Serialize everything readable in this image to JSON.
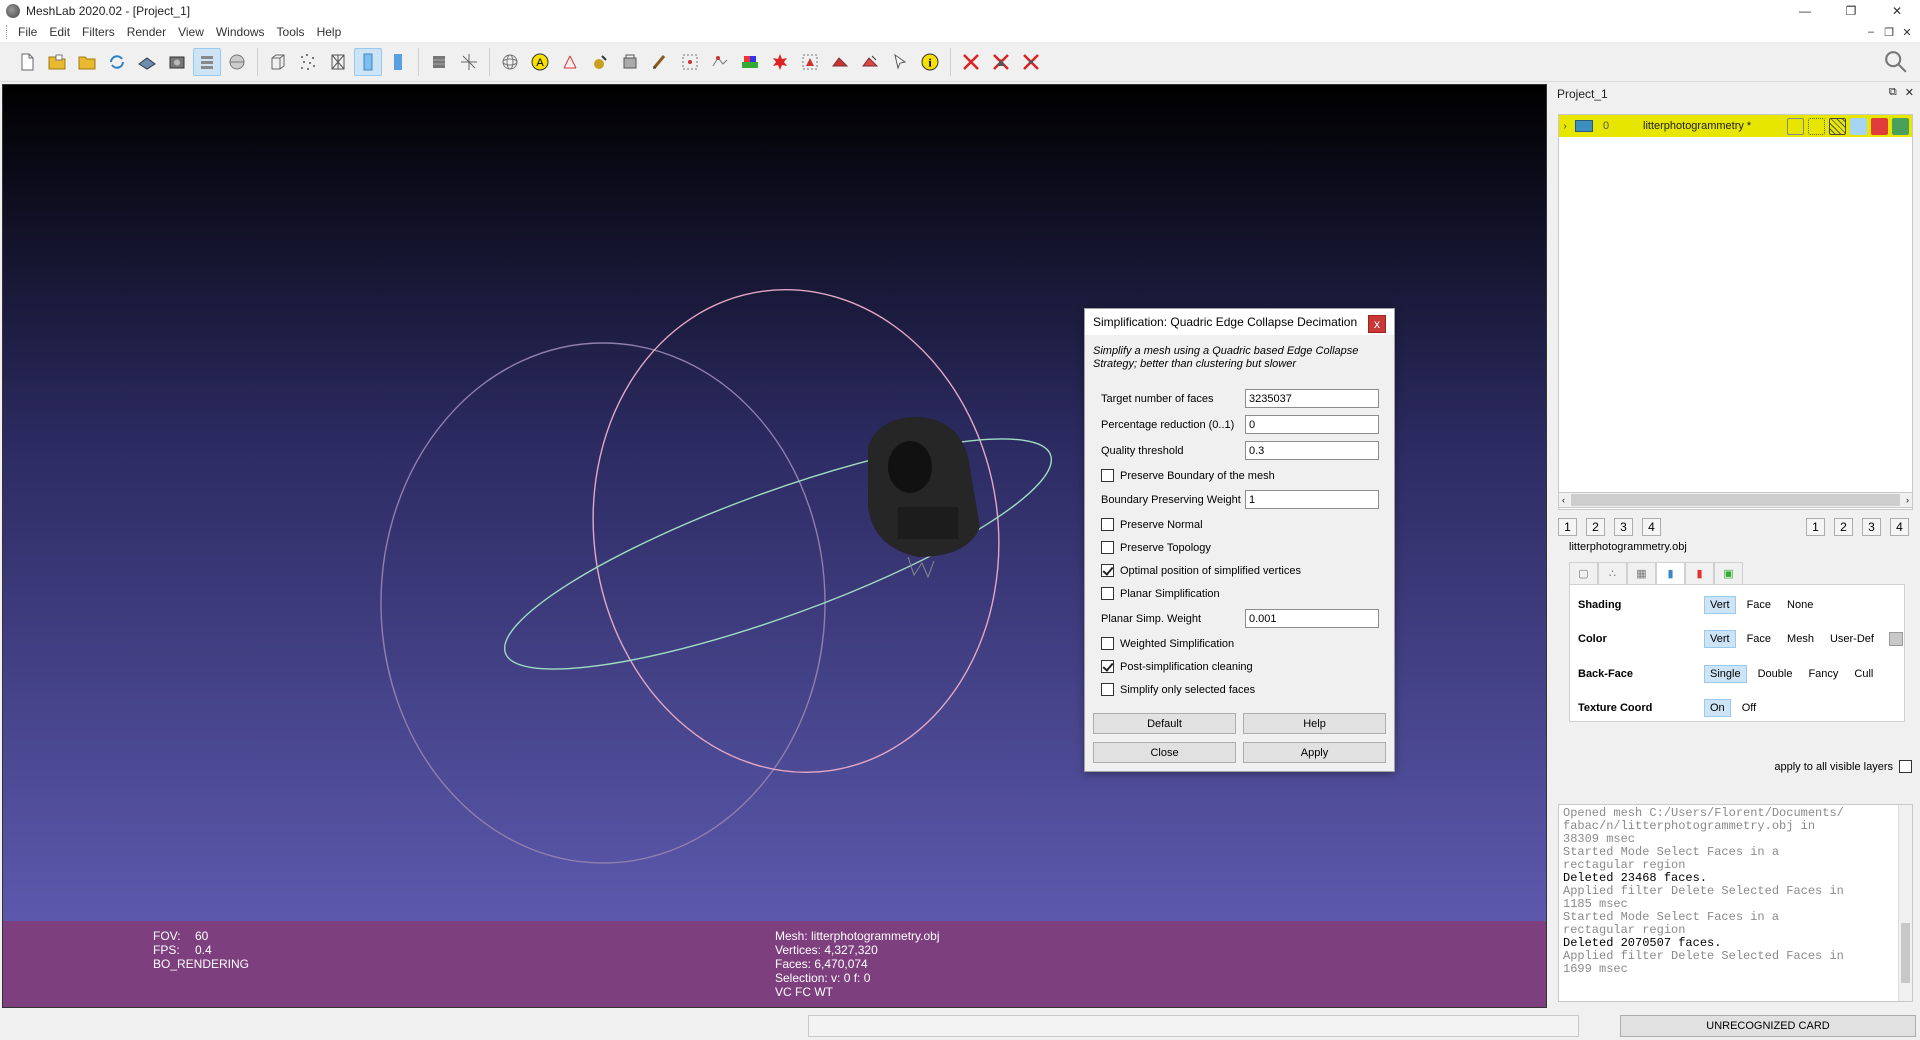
{
  "window": {
    "title": "MeshLab 2020.02 - [Project_1]",
    "controls": {
      "minimize": "—",
      "restore": "❐",
      "close": "✕"
    }
  },
  "menu": {
    "items": [
      "File",
      "Edit",
      "Filters",
      "Render",
      "View",
      "Windows",
      "Tools",
      "Help"
    ],
    "mdi_controls": {
      "minimize": "–",
      "restore": "❐",
      "close": "✕"
    }
  },
  "toolbar": {
    "icons": [
      "new-project-icon",
      "open-project-icon",
      "open-mesh-icon",
      "reload-icon",
      "save-icon",
      "snapshot-icon",
      "layers-icon",
      "render-points-icon",
      "bbox-icon",
      "points-icon",
      "wireframe-icon",
      "smooth-icon",
      "texture-icon",
      "lighting-icon",
      "axis-icon",
      "trackball-icon",
      "annotation-icon",
      "measure-icon",
      "align-icon",
      "paint-bucket-icon",
      "brush-icon",
      "select-vertex-icon",
      "select-connected-icon",
      "color-map-icon",
      "georef-icon",
      "select-faces-icon",
      "select-paint-icon",
      "delete-faces-icon",
      "pick-icon",
      "info-icon",
      "delete-vertices-icon",
      "delete-faces-x-icon",
      "delete-both-icon"
    ],
    "active": [
      "layers-icon",
      "smooth-icon"
    ]
  },
  "viewport": {
    "info_left": [
      {
        "k": "FOV:",
        "v": "60"
      },
      {
        "k": "FPS:",
        "v": "0.4"
      },
      {
        "k": "BO_RENDERING",
        "v": ""
      }
    ],
    "info_mid": [
      "Mesh: litterphotogrammetry.obj",
      "Vertices: 4,327,320",
      "Faces: 6,470,074",
      "Selection: v: 0 f: 0",
      "VC FC WT"
    ]
  },
  "dialog": {
    "title": "Simplification: Quadric Edge Collapse Decimation",
    "close": "x",
    "description": "Simplify a mesh using a Quadric based Edge Collapse Strategy; better than clustering but slower",
    "params": {
      "target_faces": {
        "label": "Target number of faces",
        "value": "3235037"
      },
      "percentage": {
        "label": "Percentage reduction (0..1)",
        "value": "0"
      },
      "quality": {
        "label": "Quality threshold",
        "value": "0.3"
      },
      "preserve_boundary": {
        "label": "Preserve Boundary of the mesh",
        "checked": false
      },
      "boundary_weight": {
        "label": "Boundary Preserving Weight",
        "value": "1"
      },
      "preserve_normal": {
        "label": "Preserve Normal",
        "checked": false
      },
      "preserve_topology": {
        "label": "Preserve Topology",
        "checked": false
      },
      "optimal_position": {
        "label": "Optimal position of simplified vertices",
        "checked": true
      },
      "planar": {
        "label": "Planar Simplification",
        "checked": false
      },
      "planar_weight": {
        "label": "Planar Simp. Weight",
        "value": "0.001"
      },
      "weighted": {
        "label": "Weighted Simplification",
        "checked": false
      },
      "post_cleaning": {
        "label": "Post-simplification cleaning",
        "checked": true
      },
      "selected_only": {
        "label": "Simplify only selected faces",
        "checked": false
      }
    },
    "buttons": {
      "default": "Default",
      "help": "Help",
      "close": "Close",
      "apply": "Apply"
    }
  },
  "layers_panel": {
    "title": "Project_1",
    "controls": {
      "float": "⧉",
      "close": "✕"
    },
    "layer": {
      "index": "0",
      "name": "litterphotogrammetry *"
    },
    "scroll": {
      "left": "‹",
      "right": "›"
    },
    "view_buttons_left": [
      "1",
      "2",
      "3",
      "4"
    ],
    "view_buttons_right": [
      "1",
      "2",
      "3",
      "4"
    ],
    "mesh_name": "litterphotogrammetry.obj"
  },
  "render_options": {
    "rows": [
      {
        "label": "Shading",
        "options": [
          "Vert",
          "Face",
          "None"
        ],
        "selected": "Vert"
      },
      {
        "label": "Color",
        "options": [
          "Vert",
          "Face",
          "Mesh",
          "User-Def"
        ],
        "selected": "Vert"
      },
      {
        "label": "Back-Face",
        "options": [
          "Single",
          "Double",
          "Fancy",
          "Cull"
        ],
        "selected": "Single"
      },
      {
        "label": "Texture Coord",
        "options": [
          "On",
          "Off"
        ],
        "selected": "On"
      }
    ],
    "apply_all": "apply to all visible layers"
  },
  "log": [
    {
      "text": "Opened mesh C:/Users/Florent/Documents/",
      "strong": false
    },
    {
      "text": "fabac/n/litterphotogrammetry.obj in",
      "strong": false
    },
    {
      "text": "38309 msec",
      "strong": false
    },
    {
      "text": "Started Mode Select Faces in a",
      "strong": false
    },
    {
      "text": "rectagular region",
      "strong": false
    },
    {
      "text": "Deleted 23468 faces.",
      "strong": true
    },
    {
      "text": "Applied filter Delete Selected Faces in",
      "strong": false
    },
    {
      "text": "1185 msec",
      "strong": false
    },
    {
      "text": "Started Mode Select Faces in a",
      "strong": false
    },
    {
      "text": "rectagular region",
      "strong": false
    },
    {
      "text": "Deleted 2070507 faces.",
      "strong": true
    },
    {
      "text": "Applied filter Delete Selected Faces in",
      "strong": false
    },
    {
      "text": "1699 msec",
      "strong": false
    }
  ],
  "statusbar": {
    "card": "UNRECOGNIZED CARD"
  },
  "colors": {
    "layer_highlight": "#e6e600",
    "info_bar": "#7e3f7f",
    "selected_option": "#cde4f7"
  }
}
